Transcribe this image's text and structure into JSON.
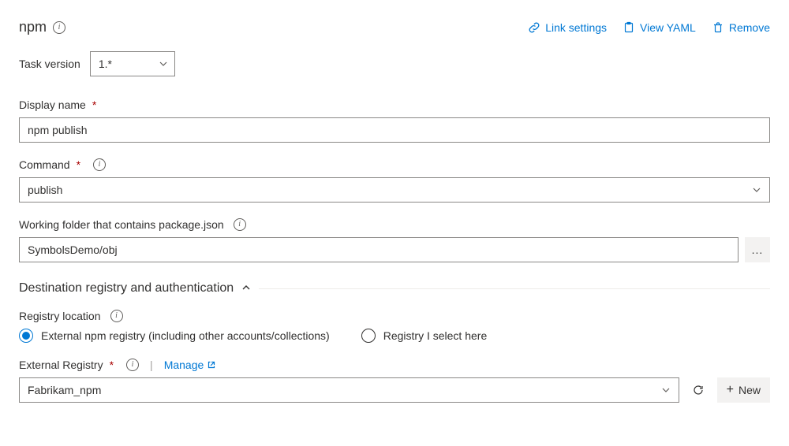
{
  "header": {
    "title": "npm",
    "link_settings": "Link settings",
    "view_yaml": "View YAML",
    "remove": "Remove"
  },
  "task_version": {
    "label": "Task version",
    "value": "1.*"
  },
  "display_name": {
    "label": "Display name",
    "value": "npm publish"
  },
  "command": {
    "label": "Command",
    "value": "publish"
  },
  "working_folder": {
    "label": "Working folder that contains package.json",
    "value": "SymbolsDemo/obj"
  },
  "section": {
    "title": "Destination registry and authentication"
  },
  "registry_location": {
    "label": "Registry location",
    "option_external": "External npm registry (including other accounts/collections)",
    "option_select_here": "Registry I select here"
  },
  "external_registry": {
    "label": "External Registry",
    "manage": "Manage",
    "value": "Fabrikam_npm",
    "new": "New"
  }
}
